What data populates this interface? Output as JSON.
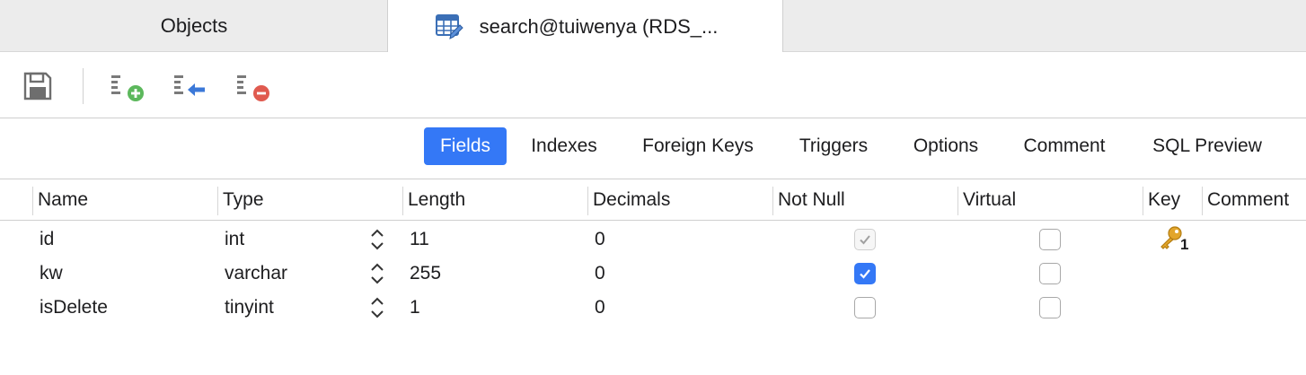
{
  "tabs": {
    "objects_label": "Objects",
    "active_label": "search@tuiwenya (RDS_..."
  },
  "toolbar": {
    "buttons": [
      "save-icon",
      "add-field-icon",
      "insert-field-icon",
      "delete-field-icon"
    ]
  },
  "subtabs": {
    "fields": "Fields",
    "indexes": "Indexes",
    "foreign_keys": "Foreign Keys",
    "triggers": "Triggers",
    "options": "Options",
    "comment": "Comment",
    "sql_preview": "SQL Preview",
    "active": "Fields",
    "accent": "#3478f6"
  },
  "columns": {
    "name": "Name",
    "type": "Type",
    "length": "Length",
    "decimals": "Decimals",
    "not_null": "Not Null",
    "virtual": "Virtual",
    "key": "Key",
    "comment": "Comment"
  },
  "rows": [
    {
      "name": "id",
      "type": "int",
      "length": "11",
      "decimals": "0",
      "not_null": "checked-disabled",
      "virtual": false,
      "key": "1"
    },
    {
      "name": "kw",
      "type": "varchar",
      "length": "255",
      "decimals": "0",
      "not_null": "checked",
      "virtual": false,
      "key": ""
    },
    {
      "name": "isDelete",
      "type": "tinyint",
      "length": "1",
      "decimals": "0",
      "not_null": "unchecked",
      "virtual": false,
      "key": ""
    }
  ]
}
